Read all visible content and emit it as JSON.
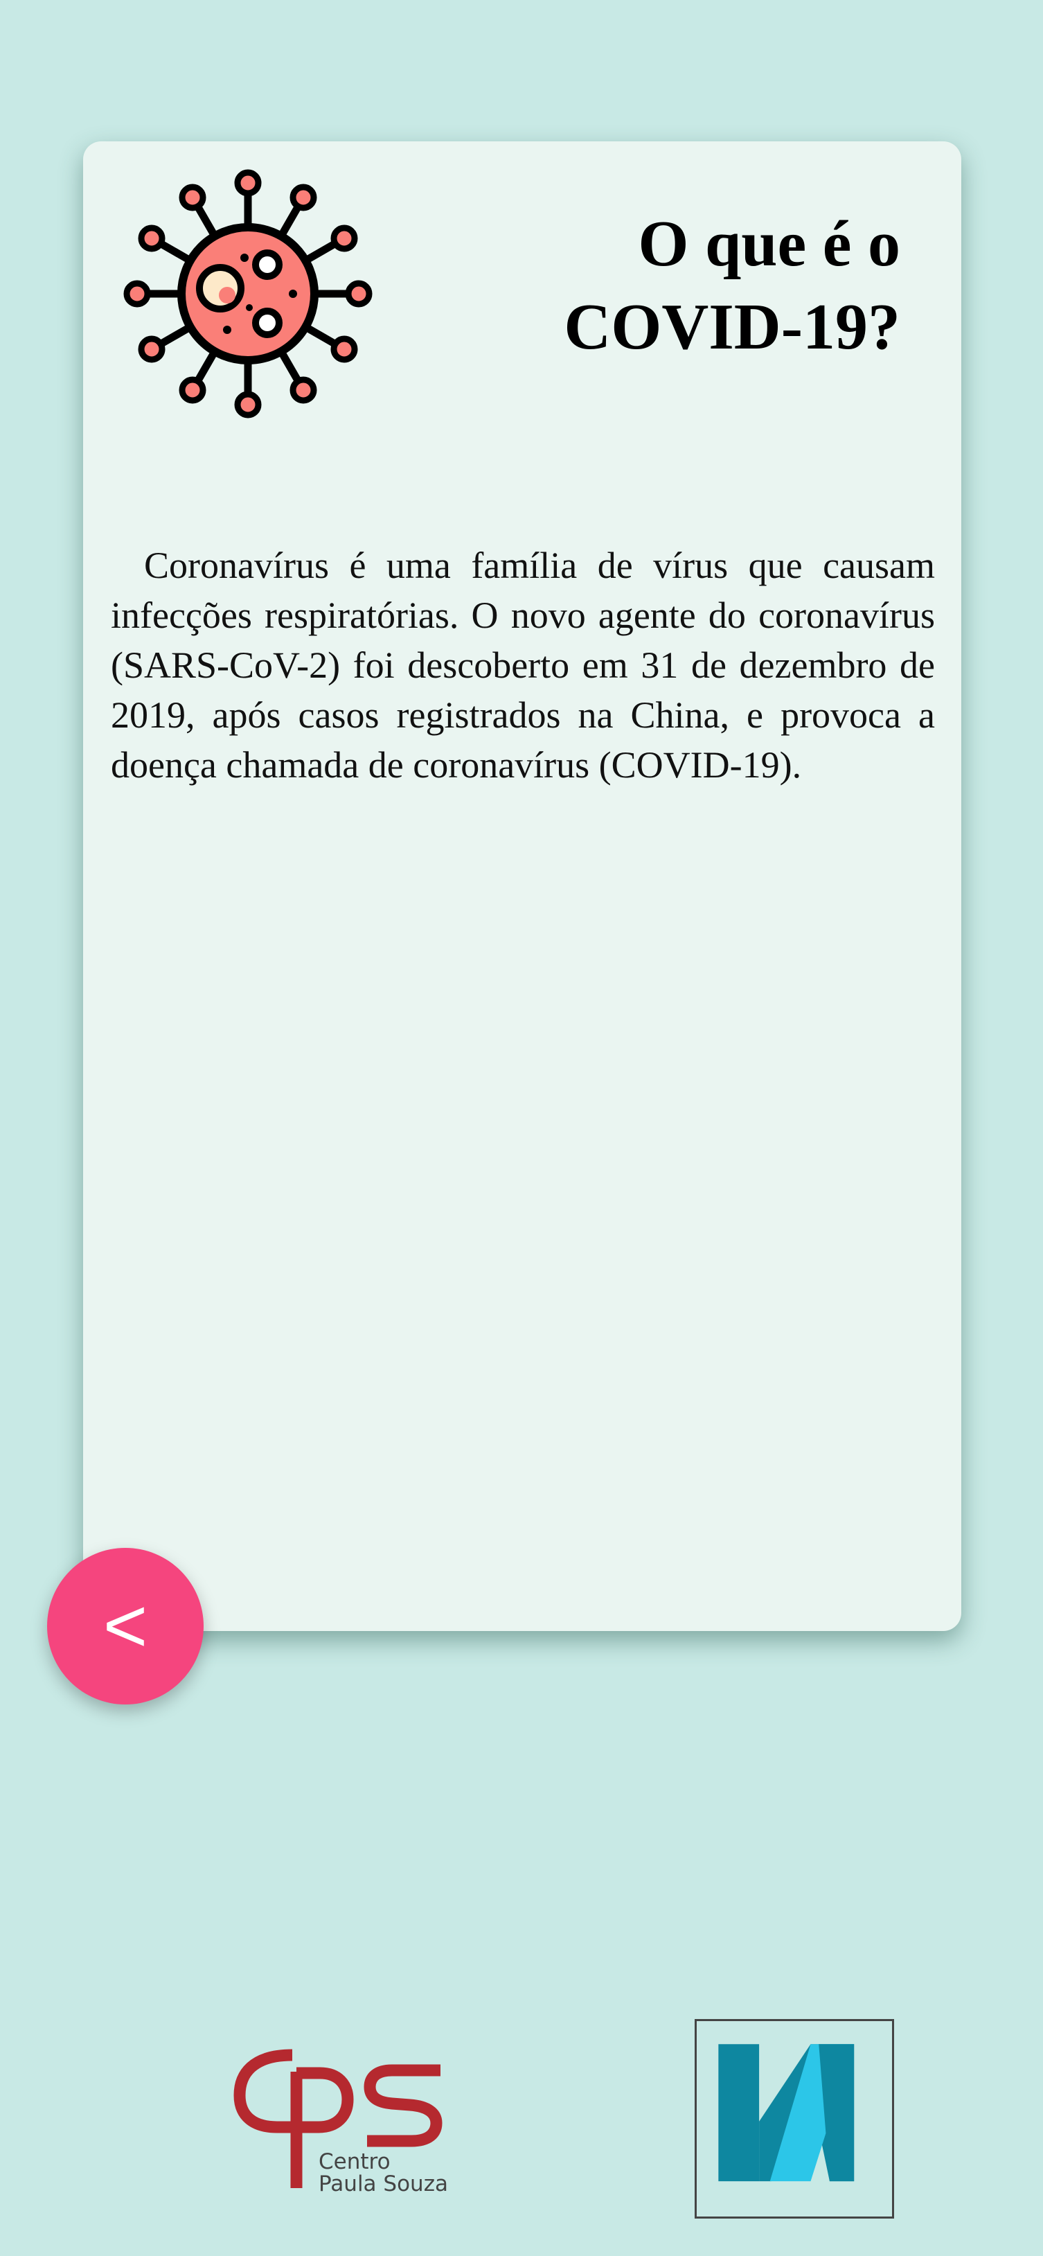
{
  "card": {
    "title": "O que é o COVID-19?",
    "body": "Coronavírus é uma família de vírus que causam infecções respiratórias. O novo agente do coronavírus (SARS-CoV-2) foi descoberto em 31 de dezembro de 2019, após casos registrados na China, e provoca a doença chamada de coronavírus (COVID-19).",
    "illustration_icon": "virus-icon"
  },
  "navigation": {
    "back_label": "<"
  },
  "footer": {
    "logo_left": {
      "icon": "cps-logo",
      "line1": "Centro",
      "line2": "Paula Souza"
    },
    "logo_right": {
      "icon": "k-logo"
    }
  },
  "colors": {
    "background": "#c8e9e5",
    "card": "#eaf5f1",
    "button": "#f5457e",
    "virus_body": "#fa7f78",
    "cps_red": "#b5292f",
    "k_dark": "#0e87a0",
    "k_light": "#2cc6e8"
  }
}
